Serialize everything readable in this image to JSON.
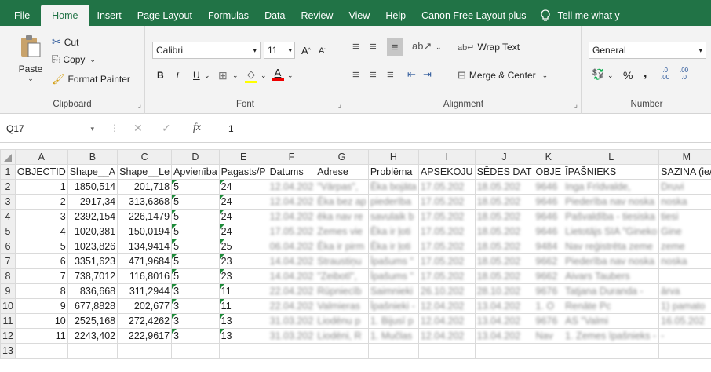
{
  "menu": {
    "tabs": [
      "File",
      "Home",
      "Insert",
      "Page Layout",
      "Formulas",
      "Data",
      "Review",
      "View",
      "Help",
      "Canon Free Layout plus"
    ],
    "active_tab": "Home",
    "tell_me": "Tell me what y"
  },
  "ribbon": {
    "clipboard": {
      "paste": "Paste",
      "cut": "Cut",
      "copy": "Copy",
      "format_painter": "Format Painter",
      "label": "Clipboard"
    },
    "font": {
      "name": "Calibri",
      "size": "11",
      "bold": "B",
      "italic": "I",
      "underline": "U",
      "label": "Font",
      "grow": "A",
      "shrink": "A"
    },
    "alignment": {
      "wrap": "Wrap Text",
      "merge": "Merge & Center",
      "label": "Alignment"
    },
    "number": {
      "format": "General",
      "percent": "%",
      "comma": ",",
      "label": "Number",
      "inc_decimal": ".00",
      "dec_decimal": ".0"
    }
  },
  "formula_bar": {
    "name_box": "Q17",
    "fx": "fx",
    "value": "1"
  },
  "sheet": {
    "columns": [
      "A",
      "B",
      "C",
      "D",
      "E",
      "F",
      "G",
      "H",
      "I",
      "J",
      "K",
      "L",
      "M"
    ],
    "rows": [
      {
        "n": "1",
        "cells": [
          "OBJECTID",
          "Shape__A",
          "Shape__Le",
          "Apvienība",
          "Pagasts/P",
          "Datums",
          "Adrese",
          "Problēma",
          "APSEKOJU",
          "SĒDES DAT",
          "OBJE",
          "ĪPAŠNIEKS",
          "SAZINA (ie/"
        ]
      },
      {
        "n": "2",
        "cells": [
          "1",
          "1850,514",
          "201,718",
          "5",
          "24",
          "12.04.202",
          "\"Vārpas\",",
          "Ēka bojāta",
          "17.05.202",
          "18.05.202",
          "9646",
          "Inga Frīdvalde,",
          "Druvi"
        ]
      },
      {
        "n": "3",
        "cells": [
          "2",
          "2917,34",
          "313,6368",
          "5",
          "24",
          "12.04.202",
          "Ēka bez ap",
          "piederība",
          "17.05.202",
          "18.05.202",
          "9646",
          "Piederība nav noska",
          "noska"
        ]
      },
      {
        "n": "4",
        "cells": [
          "3",
          "2392,154",
          "226,1479",
          "5",
          "24",
          "12.04.202",
          "ēka nav re",
          "savulaik b",
          "17.05.202",
          "18.05.202",
          "9646",
          "Pašvaldība - tiesiska",
          "tiesi"
        ]
      },
      {
        "n": "5",
        "cells": [
          "4",
          "1020,381",
          "150,0194",
          "5",
          "24",
          "17.05.202",
          "Zemes vie",
          "Ēka ir ļoti",
          "17.05.202",
          "18.05.202",
          "9646",
          "Lietotājs SIA \"Gineko",
          "Gine"
        ]
      },
      {
        "n": "6",
        "cells": [
          "5",
          "1023,826",
          "134,9414",
          "5",
          "25",
          "06.04.202",
          "Ēka ir pirm",
          "Ēka ir ļoti",
          "17.05.202",
          "18.05.202",
          "9484",
          "Nav reģistrēta zeme",
          "zeme"
        ]
      },
      {
        "n": "7",
        "cells": [
          "6",
          "3351,623",
          "471,9684",
          "5",
          "23",
          "14.04.202",
          "Straustiņu",
          "Īpašums \"",
          "17.05.202",
          "18.05.202",
          "9662",
          "Piederība nav noska",
          "noska"
        ]
      },
      {
        "n": "8",
        "cells": [
          "7",
          "738,7012",
          "116,8016",
          "5",
          "23",
          "14.04.202",
          "\"Zeibotī\",",
          "Īpašums \"",
          "17.05.202",
          "18.05.202",
          "9662",
          "Aivars Taubers",
          ""
        ]
      },
      {
        "n": "9",
        "cells": [
          "8",
          "836,668",
          "311,2944",
          "3",
          "11",
          "22.04.202",
          "Rūpniecīb",
          "Saimnieki",
          "26.10.202",
          "28.10.202",
          "9676",
          "Tatjana Duranda -",
          "ārva"
        ]
      },
      {
        "n": "10",
        "cells": [
          "9",
          "677,8828",
          "202,677",
          "3",
          "11",
          "22.04.202",
          "Valmieras",
          "Īpašnieki -",
          "12.04.202",
          "13.04.202",
          "1. O",
          "Renāte Pc",
          "1) pamato"
        ]
      },
      {
        "n": "11",
        "cells": [
          "10",
          "2525,168",
          "272,4262",
          "3",
          "13",
          "31.03.202",
          "Liodēnu p",
          "1. Bijusī p",
          "12.04.202",
          "13.04.202",
          "9676",
          "AS \"Valmi",
          "16.05.202"
        ]
      },
      {
        "n": "12",
        "cells": [
          "11",
          "2243,402",
          "222,9617",
          "3",
          "13",
          "31.03.202",
          "Liodēni, R",
          "1. Mučlas",
          "12.04.202",
          "13.04.202",
          "Nav",
          "1. Zemes īpašnieks -",
          "-"
        ]
      },
      {
        "n": "13",
        "cells": [
          "",
          "",
          "",
          "",
          "",
          "",
          "",
          "",
          "",
          "",
          "",
          "",
          ""
        ]
      }
    ]
  }
}
